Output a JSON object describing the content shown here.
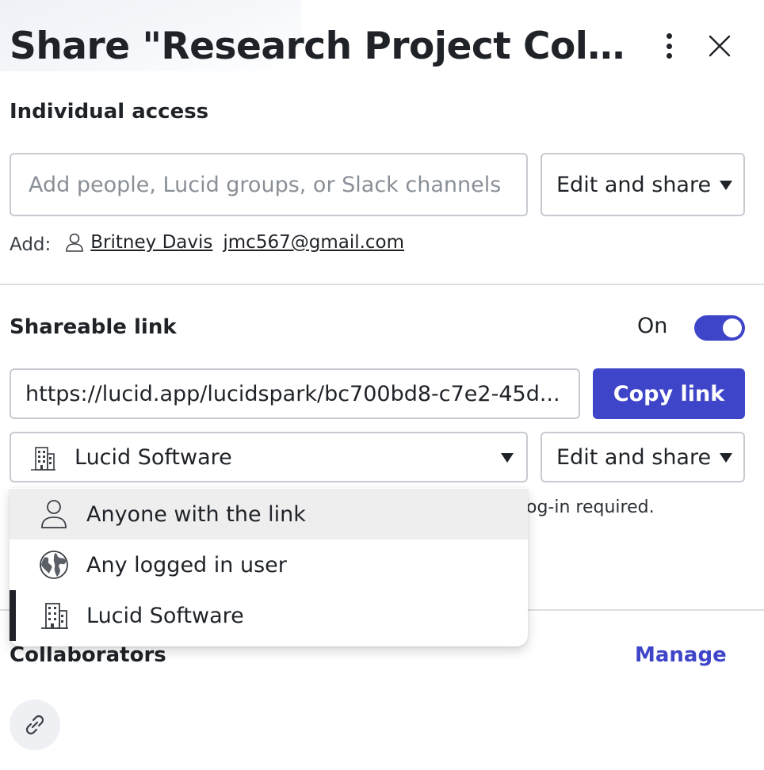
{
  "dialog": {
    "title": "Share \"Research Project Collaboration\"",
    "more_icon": "kebab-vertical-icon",
    "close_icon": "close-x-icon"
  },
  "individual_access": {
    "heading": "Individual access",
    "input_placeholder": "Add people, Lucid groups, or Slack channels",
    "input_value": "",
    "permission": "Edit and share",
    "add_label": "Add:",
    "suggestions": [
      "Britney Davis",
      "jmc567@gmail.com"
    ]
  },
  "shareable_link": {
    "heading": "Shareable link",
    "toggle_label": "On",
    "toggle_on": true,
    "url": "https://lucid.app/lucidspark/bc700bd8-c7e2-45d...",
    "copy_label": "Copy link",
    "audience_selected": "Lucid Software",
    "permission": "Edit and share",
    "note_fragment": "og-in required."
  },
  "audience_menu": {
    "items": [
      {
        "label": "Anyone with the link",
        "icon": "person-icon",
        "state": "hover"
      },
      {
        "label": "Any logged in user",
        "icon": "globe-icon",
        "state": ""
      },
      {
        "label": "Lucid Software",
        "icon": "building-icon",
        "state": "selected"
      }
    ]
  },
  "collaborators": {
    "heading": "Collaborators",
    "manage_label": "Manage",
    "link_icon": "link-icon"
  },
  "colors": {
    "accent": "#3f45c8",
    "text": "#1f2328",
    "border": "#c7cbd1",
    "hover": "#eeeeef"
  }
}
